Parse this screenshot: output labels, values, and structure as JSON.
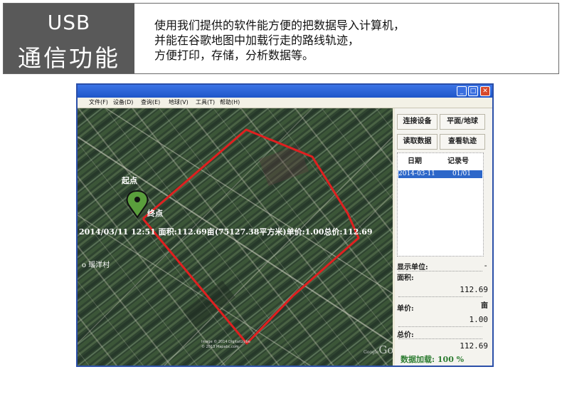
{
  "banner": {
    "feature_line1": "USB",
    "feature_line2": "通信功能",
    "desc_lines": [
      "使用我们提供的软件能方便的把数据导入计算机，",
      "并能在谷歌地图中加载行走的路线轨迹，",
      "方便打印，存储，分析数据等。"
    ]
  },
  "window": {
    "minimize_glyph": "_",
    "maximize_glyph": "□",
    "close_glyph": "✕"
  },
  "menu": [
    "文件(F)",
    "设备(D)",
    "查询(E)",
    "地球(V)",
    "工具(T)",
    "帮助(H)"
  ],
  "map": {
    "start_label": "起点",
    "end_label": "终点",
    "info": "2014/03/11 12:51 面积:112.69亩(75127.38平方米)单价:1.00总价:112.69",
    "village": "o 瑶洋村",
    "copyright_line1": "Image © 2014 DigitalGlobe",
    "copyright_line2": "© 2013 Mapabc.com",
    "google_small": "Google",
    "google": "Goog",
    "marker_color": "#5a9e3c",
    "track_color": "#e02020"
  },
  "panel": {
    "btn_connect": "连接设备",
    "btn_view_mode": "平面/地球",
    "btn_read": "读取数据",
    "btn_track": "查看轨迹",
    "col_date": "日期",
    "col_record": "记录号",
    "row_date": "2014-03-11",
    "row_record": "01/01",
    "unit_label": "显示单位:",
    "unit_value": "-",
    "area_label": "面积:",
    "area_value": "112.69",
    "area_unit": "亩",
    "price_label": "单价:",
    "price_value": "1.00",
    "total_label": "总价:",
    "total_value": "112.69",
    "loading_label": "数据加载: 100 %"
  }
}
